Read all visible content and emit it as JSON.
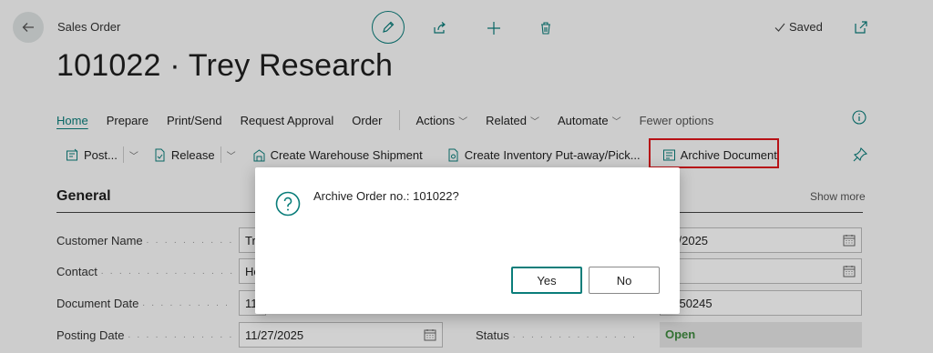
{
  "header": {
    "page_type": "Sales Order",
    "title": "101022 · Trey Research",
    "saved_label": "Saved"
  },
  "menu": {
    "items": [
      "Home",
      "Prepare",
      "Print/Send",
      "Request Approval",
      "Order"
    ],
    "dropdowns": [
      "Actions",
      "Related",
      "Automate"
    ],
    "fewer_options": "Fewer options"
  },
  "toolbar": {
    "post_label": "Post...",
    "release_label": "Release",
    "create_shipment_label": "Create Warehouse Shipment",
    "create_putaway_label": "Create Inventory Put-away/Pick...",
    "archive_label": "Archive Document"
  },
  "general": {
    "title": "General",
    "show_more": "Show more",
    "fields": {
      "customer_name": {
        "label": "Customer Name",
        "value": "Tr"
      },
      "contact": {
        "label": "Contact",
        "value": "He"
      },
      "document_date": {
        "label": "Document Date",
        "value": "11"
      },
      "posting_date": {
        "label": "Posting Date",
        "value": "11/27/2025"
      },
      "status": {
        "label": "Status",
        "value": "Open"
      },
      "right_date_1": "11/2025",
      "right_number": "1250245"
    }
  },
  "dialog": {
    "message": "Archive Order no.: 101022?",
    "yes_label": "Yes",
    "no_label": "No"
  },
  "colors": {
    "accent": "#0a7d7a",
    "highlight": "#e0151b",
    "status_open": "#3f8a3f"
  }
}
